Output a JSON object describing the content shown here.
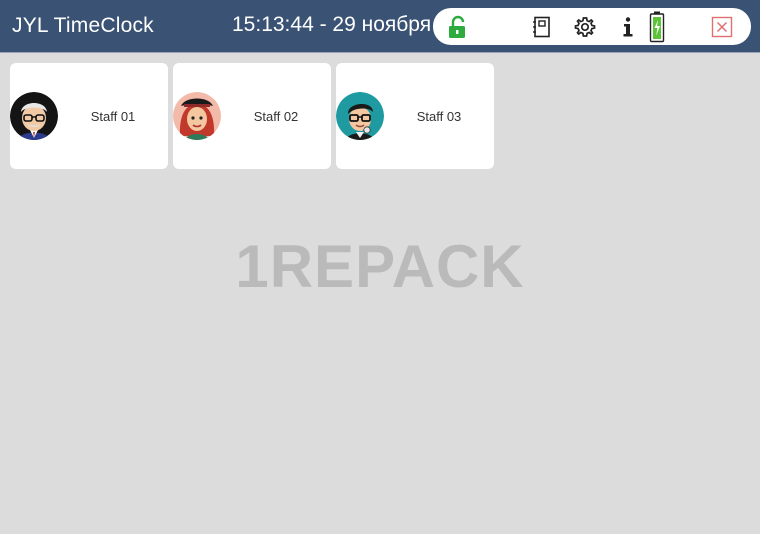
{
  "header": {
    "app_title": "JYL TimeClock",
    "clock": "15:13:44 - 29 ноября"
  },
  "toolbar": {
    "icons": {
      "lock": "unlock-icon",
      "notebook": "notebook-icon",
      "settings": "gear-icon",
      "info": "info-icon",
      "battery": "battery-charging-icon",
      "close": "close-icon"
    },
    "colors": {
      "lock": "#2eab3e",
      "battery": "#5cc43a",
      "close": "#e07070"
    }
  },
  "staff": [
    {
      "name": "Staff 01",
      "avatar": "elderly-man-avatar"
    },
    {
      "name": "Staff 02",
      "avatar": "red-haired-woman-avatar"
    },
    {
      "name": "Staff 03",
      "avatar": "young-man-glasses-avatar"
    }
  ],
  "watermark": "1REPACK",
  "colors": {
    "header_bg": "#3a5273",
    "page_bg": "#dcdcdc",
    "card_bg": "#ffffff"
  }
}
